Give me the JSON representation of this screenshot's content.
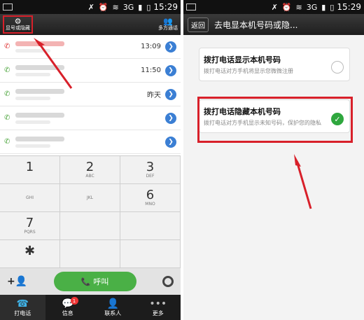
{
  "status": {
    "time": "15:29",
    "network": "3G"
  },
  "left": {
    "topbar": {
      "hide_label": "显号或隐藏",
      "multi_label": "多方通话"
    },
    "calllog": [
      {
        "time": "13:09",
        "missed": true
      },
      {
        "time": "11:50",
        "missed": false
      },
      {
        "time": "昨天",
        "missed": false
      },
      {
        "time": "",
        "missed": false
      },
      {
        "time": "",
        "missed": false
      }
    ],
    "keys": [
      {
        "num": "1",
        "sub": ""
      },
      {
        "num": "2",
        "sub": "ABC"
      },
      {
        "num": "3",
        "sub": "DEF"
      },
      {
        "num": "",
        "sub": "GHI"
      },
      {
        "num": "",
        "sub": "JKL"
      },
      {
        "num": "6",
        "sub": "MNO"
      },
      {
        "num": "7",
        "sub": "PQRS"
      },
      {
        "num": "",
        "sub": ""
      },
      {
        "num": "",
        "sub": ""
      },
      {
        "num": "✱",
        "sub": ""
      },
      {
        "num": "",
        "sub": ""
      },
      {
        "num": "",
        "sub": ""
      }
    ],
    "actionbar": {
      "add_label": "+👤",
      "call_label": "呼叫"
    },
    "tabs": [
      {
        "label": "打电话",
        "icon": "☎",
        "active": true
      },
      {
        "label": "信息",
        "icon": "💬",
        "badge": "1"
      },
      {
        "label": "联系人",
        "icon": "👤"
      },
      {
        "label": "更多",
        "icon": "•••"
      }
    ]
  },
  "right": {
    "back_label": "返回",
    "title": "去电显本机号码或隐...",
    "options": [
      {
        "title": "拨打电话显示本机号码",
        "desc": "拨打电话对方手机将显示您微微注册",
        "checked": false
      },
      {
        "title": "拨打电话隐藏本机号码",
        "desc": "拨打电话对方手机显示未知号码，保护您的隐私",
        "checked": true
      }
    ]
  },
  "colors": {
    "accent_red": "#d8202a",
    "call_green": "#4ab046",
    "check_green": "#2fa73e",
    "arrow_blue": "#3b7fd4"
  }
}
